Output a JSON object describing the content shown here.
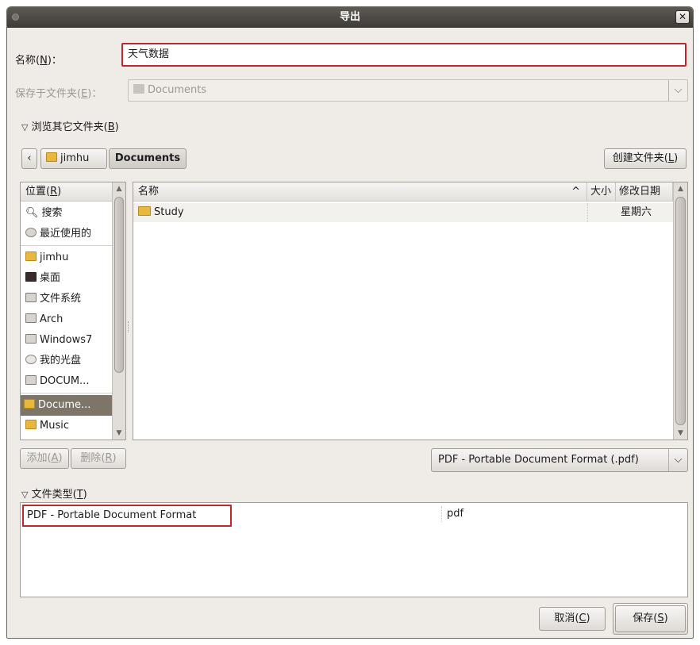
{
  "window": {
    "title": "导出"
  },
  "name_row": {
    "label": "名称(",
    "mnemonic": "N",
    "label_end": ")：",
    "value": "天气数据"
  },
  "save_in_row": {
    "label": "保存于文件夹(",
    "mnemonic": "E",
    "label_end": ")：",
    "value": "Documents"
  },
  "browse_toggle": {
    "label": "浏览其它文件夹(",
    "mnemonic": "B",
    "label_end": ")"
  },
  "path_bar": {
    "back_arrow": "‹",
    "segments": [
      "jimhu",
      "Documents"
    ],
    "create_folder": "创建文件夹(",
    "create_folder_mnemonic": "L",
    "create_folder_end": ")"
  },
  "places": {
    "header": "位置(",
    "header_mnemonic": "R",
    "header_end": ")",
    "items": [
      {
        "label": "搜索",
        "icon": "search-icon"
      },
      {
        "label": "最近使用的",
        "icon": "recent-icon"
      },
      {
        "label": "jimhu",
        "icon": "home-folder-icon"
      },
      {
        "label": "桌面",
        "icon": "desktop-icon"
      },
      {
        "label": "文件系统",
        "icon": "drive-icon"
      },
      {
        "label": "Arch",
        "icon": "drive-icon"
      },
      {
        "label": "Windows7",
        "icon": "drive-icon"
      },
      {
        "label": "我的光盘",
        "icon": "cdrom-icon"
      },
      {
        "label": "DOCUM...",
        "icon": "drive-icon"
      },
      {
        "label": "Docume...",
        "icon": "documents-folder-icon",
        "selected": true
      },
      {
        "label": "Music",
        "icon": "music-folder-icon"
      }
    ],
    "add_button": {
      "label": "添加(",
      "mnemonic": "A",
      "end": ")"
    },
    "remove_button": {
      "label": "删除(",
      "mnemonic": "R",
      "end": ")"
    }
  },
  "files": {
    "columns": {
      "name": "名称",
      "sort_arrow": "^",
      "size": "大小",
      "modified": "修改日期"
    },
    "rows": [
      {
        "name": "Study",
        "size": "",
        "modified": "星期六"
      }
    ]
  },
  "filter_combo": {
    "value": "PDF - Portable Document Format (.pdf)"
  },
  "file_type": {
    "toggle_label": "文件类型(",
    "mnemonic": "T",
    "toggle_end": ")",
    "rows": [
      {
        "name": "PDF - Portable Document Format",
        "ext": "pdf"
      }
    ]
  },
  "buttons": {
    "cancel": {
      "label": "取消(",
      "mnemonic": "C",
      "end": ")"
    },
    "save": {
      "label": "保存(",
      "mnemonic": "S",
      "end": ")"
    }
  },
  "colors": {
    "titlebar": "#3e3b37",
    "highlight": "#c0272a",
    "selection": "#7d7668",
    "folder": "#e8b73d"
  }
}
